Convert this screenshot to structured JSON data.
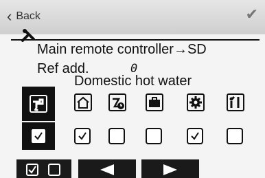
{
  "header": {
    "back_label": "Back",
    "ok_icon": "checkmark-icon",
    "settings_icon": "wrench-screwdriver-icon"
  },
  "main": {
    "line1": "Main remote controller→SD",
    "ref_label": "Ref add.",
    "ref_value": "0",
    "function_title": "Domestic hot water"
  },
  "functions": [
    {
      "icon": "faucet-icon",
      "checked": true,
      "selected": true
    },
    {
      "icon": "house-icon",
      "checked": true,
      "selected": false
    },
    {
      "icon": "schedule-clock-icon",
      "checked": false,
      "selected": false
    },
    {
      "icon": "suitcase-icon",
      "checked": false,
      "selected": false
    },
    {
      "icon": "gear-icon",
      "checked": true,
      "selected": false
    },
    {
      "icon": "service-tools-icon",
      "checked": false,
      "selected": false
    }
  ],
  "bottom": {
    "toggle_icon": "check-toggle-icon",
    "prev_icon": "arrow-left-icon",
    "next_icon": "arrow-right-icon"
  },
  "colors": {
    "background": "#f4f4f4",
    "header": "#d9d9d9",
    "foreground": "#111111"
  }
}
